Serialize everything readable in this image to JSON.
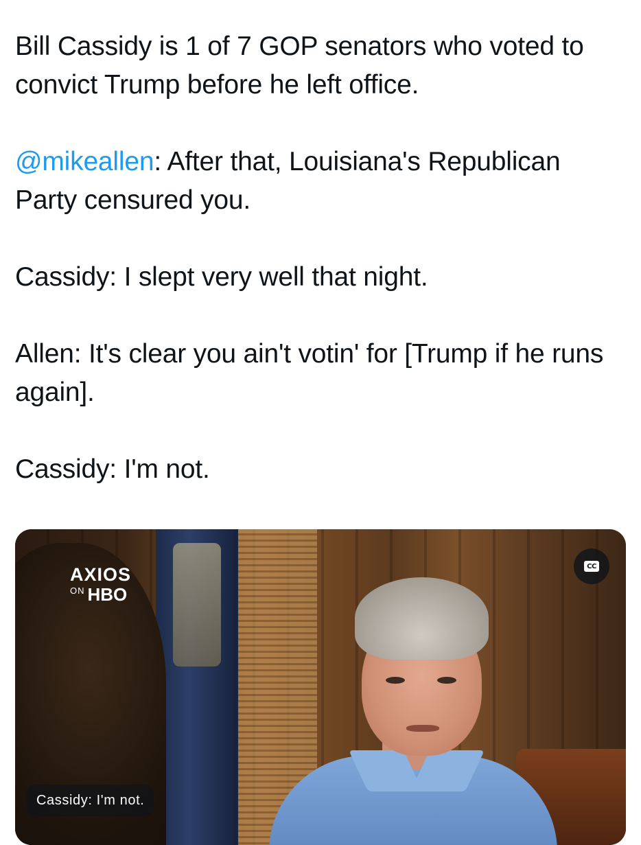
{
  "tweet": {
    "line1": "Bill Cassidy is 1 of 7 GOP senators who voted to convict Trump before he left office.",
    "mention": "@mikeallen",
    "line2_rest": ": After that, Louisiana's Republican Party censured you.",
    "line3": "Cassidy: I slept very well that night.",
    "line4": "Allen: It's clear you ain't votin' for [Trump if he runs again].",
    "line5": "Cassidy: I'm not."
  },
  "video": {
    "logo_top": "AXIOS",
    "logo_on": "ON",
    "logo_network": "HBO",
    "cc_label": "CC",
    "caption": "Cassidy: I'm not."
  },
  "colors": {
    "text": "#0f1419",
    "mention": "#1d9bf0",
    "background": "#ffffff"
  },
  "icons": [
    "closed-captions-icon"
  ]
}
